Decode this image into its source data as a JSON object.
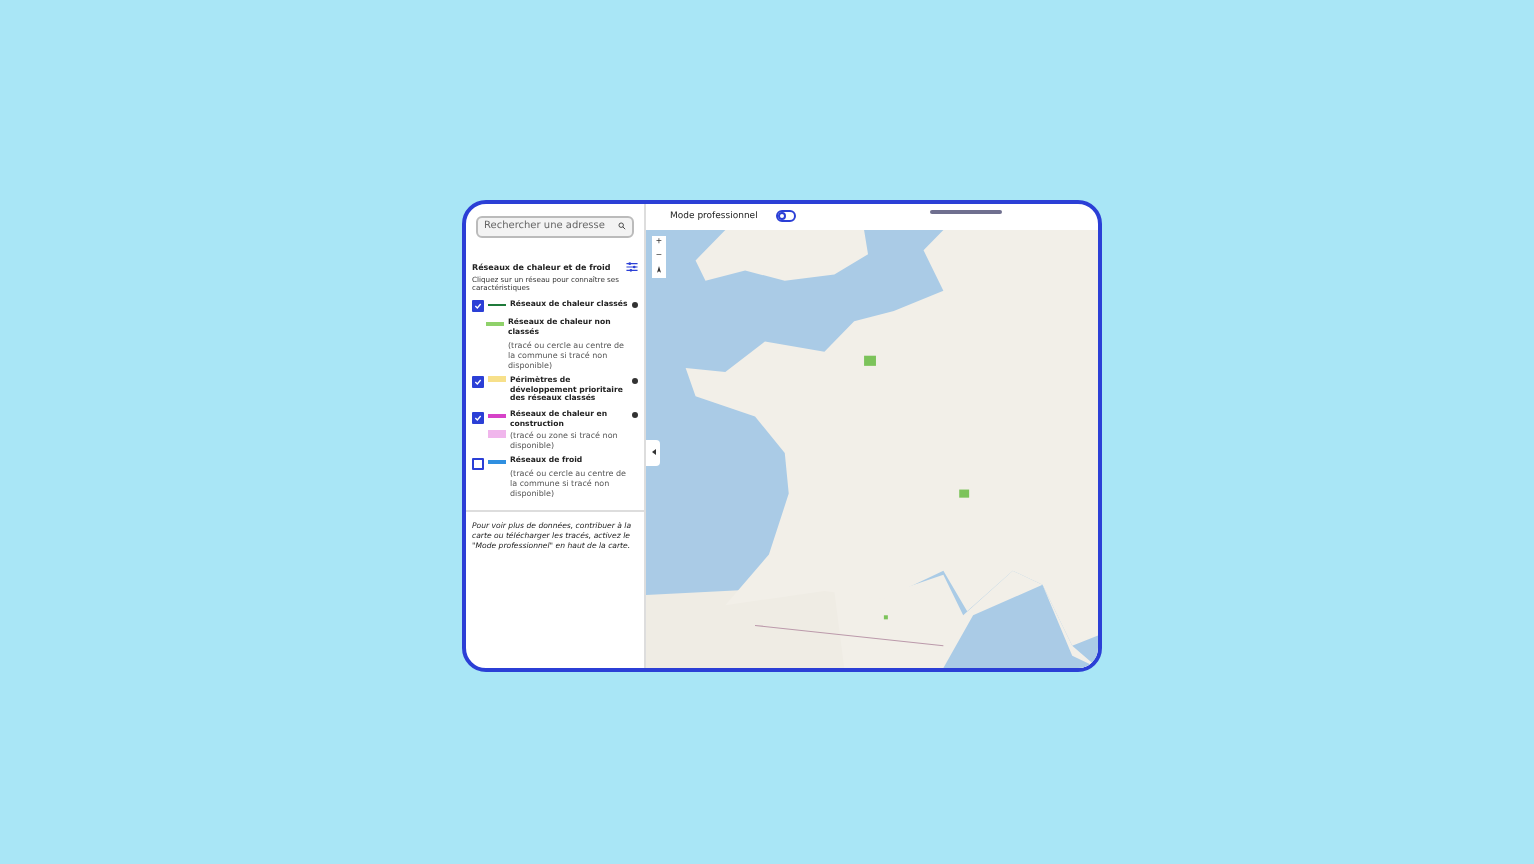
{
  "search": {
    "placeholder": "Rechercher une adresse"
  },
  "legend": {
    "title": "Réseaux de chaleur et de froid",
    "hint": "Cliquez sur un réseau pour connaître ses caractéristiques",
    "items": [
      {
        "kind": "checkbox",
        "checked": true,
        "swatch": {
          "kind": "line",
          "color": "#1f7a3a"
        },
        "label": "Réseaux de chaleur classés",
        "info": true
      },
      {
        "kind": "plain",
        "swatch": {
          "kind": "line",
          "color": "#8fd16a"
        },
        "label": "Réseaux de chaleur non classés",
        "note": "(tracé ou cercle au centre de la commune si tracé non disponible)",
        "info": false
      },
      {
        "kind": "checkbox",
        "checked": true,
        "swatch": {
          "kind": "area",
          "color": "#f7e08a"
        },
        "label": "Périmètres de développement prioritaire des réseaux classés",
        "info": true
      },
      {
        "kind": "checkbox",
        "checked": true,
        "swatch": {
          "kind": "line",
          "color": "#d642c8"
        },
        "label": "Réseaux de chaleur en construction",
        "note_swatch": {
          "kind": "area",
          "color": "#f0b6ec"
        },
        "note": "(tracé ou zone si tracé non disponible)",
        "info": true
      },
      {
        "kind": "checkbox",
        "checked": false,
        "swatch": {
          "kind": "line",
          "color": "#2f8fe0"
        },
        "label": "Réseaux de froid",
        "note": "(tracé ou cercle au centre de la commune si tracé non disponible)",
        "info": false
      }
    ]
  },
  "footer": "Pour voir plus de données, contribuer à la carte ou télécharger les tracés, activez le \"Mode professionnel\" en haut de la carte.",
  "pro_mode": {
    "label": "Mode professionnel",
    "on": false
  },
  "zoom": {
    "plus": "+",
    "minus": "−"
  }
}
